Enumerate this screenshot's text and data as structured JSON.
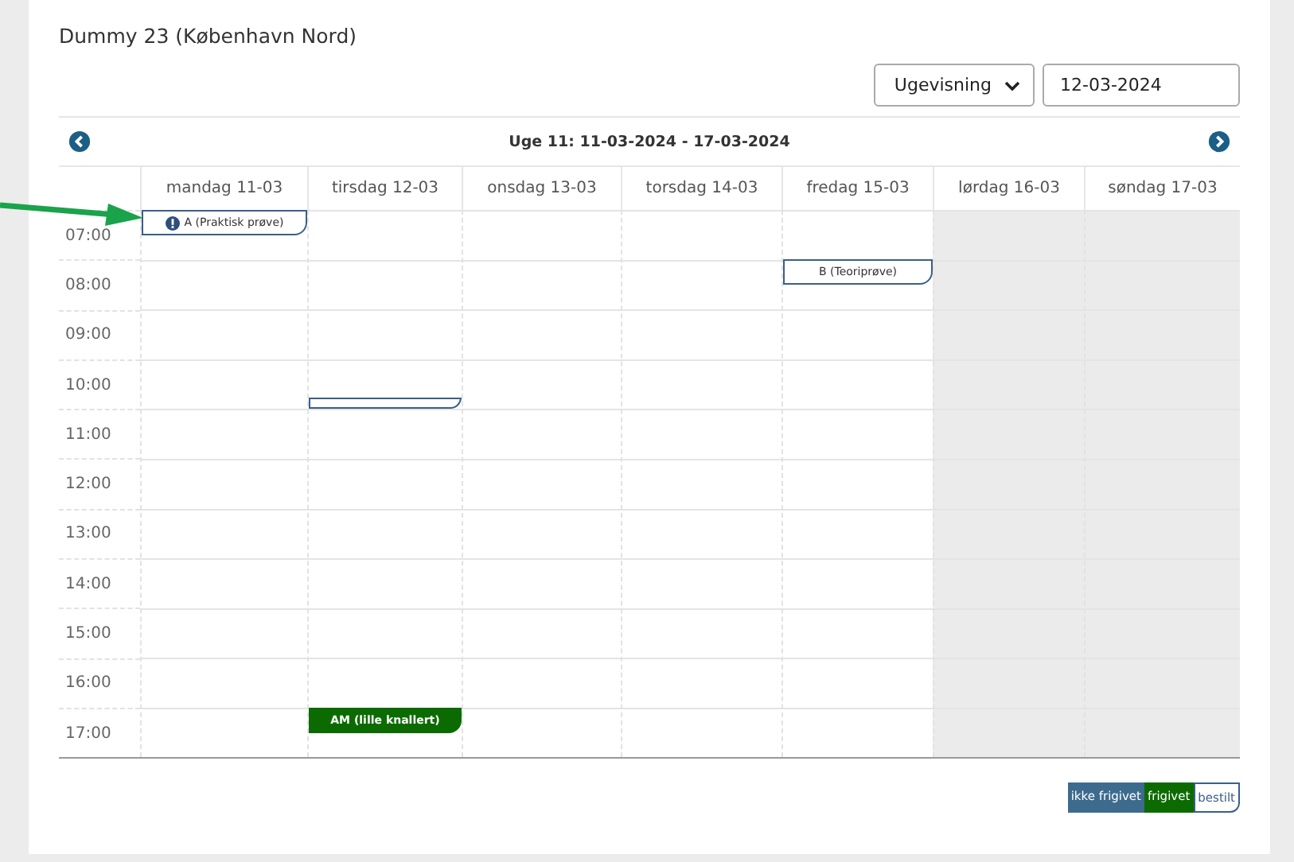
{
  "title": "Dummy 23 (København Nord)",
  "view_select": {
    "value": "Ugevisning"
  },
  "date_field": {
    "value": "12-03-2024"
  },
  "week_label": "Uge 11: 11-03-2024 - 17-03-2024",
  "times": [
    "07:00",
    "08:00",
    "09:00",
    "10:00",
    "11:00",
    "12:00",
    "13:00",
    "14:00",
    "15:00",
    "16:00",
    "17:00"
  ],
  "days": [
    {
      "label": "mandag 11-03",
      "weekend": false,
      "cells": [
        {
          "kind": "top",
          "color": "#ffffff",
          "warning": true,
          "title": "A (Praktisk prøve)"
        },
        null,
        null,
        null,
        null,
        null,
        null,
        null,
        null,
        null,
        null
      ]
    },
    {
      "label": "tirsdag 12-03",
      "weekend": false,
      "cells": [
        null,
        null,
        null,
        {
          "kind": "bottom-sliver",
          "color": "#ffffff"
        },
        null,
        null,
        null,
        null,
        null,
        null,
        {
          "kind": "top",
          "color": "#0b6b00",
          "title": "AM (lille knallert)"
        }
      ]
    },
    {
      "label": "onsdag 13-03",
      "weekend": false,
      "cells": [
        null,
        null,
        null,
        null,
        null,
        null,
        null,
        null,
        null,
        null,
        null
      ]
    },
    {
      "label": "torsdag 14-03",
      "weekend": false,
      "cells": [
        null,
        null,
        null,
        null,
        null,
        null,
        null,
        null,
        null,
        null,
        null
      ]
    },
    {
      "label": "fredag 15-03",
      "weekend": false,
      "cells": [
        null,
        {
          "kind": "top",
          "color": "#ffffff",
          "title": "B (Teoriprøve)"
        },
        null,
        null,
        null,
        null,
        null,
        null,
        null,
        null,
        null
      ]
    },
    {
      "label": "lørdag 16-03",
      "weekend": true,
      "cells": [
        null,
        null,
        null,
        null,
        null,
        null,
        null,
        null,
        null,
        null,
        null
      ]
    },
    {
      "label": "søndag 17-03",
      "weekend": true,
      "cells": [
        null,
        null,
        null,
        null,
        null,
        null,
        null,
        null,
        null,
        null,
        null
      ]
    }
  ],
  "legend": [
    {
      "label": "ikke frigivet",
      "color": "#3d6b8e"
    },
    {
      "label": "frigivet",
      "color": "#0b6b00"
    },
    {
      "label": "bestilt",
      "color": "#ffffff"
    }
  ]
}
